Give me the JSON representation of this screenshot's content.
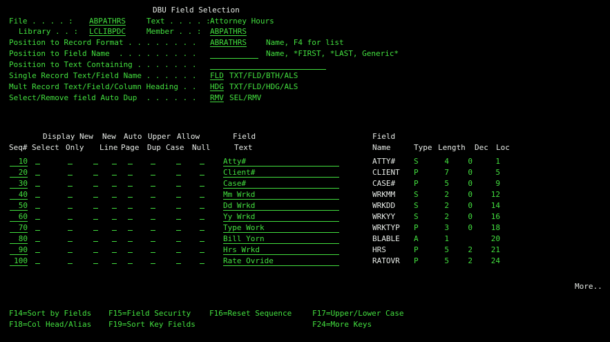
{
  "title": "DBU Field Selection",
  "header": {
    "file_label": "File . . . . :",
    "file_value": "ABPATHRS",
    "text_label": "Text . . . . :",
    "text_value": "Attorney Hours",
    "library_label": "Library . . :",
    "library_value": "LCLIBPDC",
    "member_label": "Member . . :",
    "member_value": "ABPATHRS",
    "pos_record_label": "Position to Record Format . . . . . . . .",
    "pos_record_value": "ABRATHRS",
    "pos_record_hint": "Name, F4 for list",
    "pos_field_label": "Position to Field Name  . . . . . . . . .",
    "pos_field_value": "",
    "pos_field_hint": "Name, *FIRST, *LAST, Generic*",
    "pos_text_label": "Position to Text Containing . . . . . . .",
    "pos_text_value": "",
    "single_label": "Single Record Text/Field Name . . . . . .",
    "single_value": "FLD",
    "single_hint": "TXT/FLD/BTH/ALS",
    "mult_label": "Mult Record Text/Field/Column Heading . .",
    "mult_value": "HDG",
    "mult_hint": "TXT/FLD/HDG/ALS",
    "select_label": "Select/Remove field Auto Dup  . . . . . .",
    "select_value": "RMV",
    "select_hint": "SEL/RMV"
  },
  "columns": {
    "row1": [
      "Display",
      "New",
      "New",
      "Auto",
      "Upper",
      "Allow",
      "Field",
      "Field"
    ],
    "row2": [
      "Seq#",
      "Select",
      "Only",
      "Line",
      "Page",
      "Dup",
      "Case",
      "Null",
      "Text",
      "Name",
      "Type",
      "Length",
      "Dec",
      "Loc"
    ]
  },
  "rows": [
    {
      "seq": "10",
      "text": "Atty#",
      "name": "ATTY#",
      "type": "S",
      "length": "4",
      "dec": "0",
      "loc": "1"
    },
    {
      "seq": "20",
      "text": "Client#",
      "name": "CLIENT",
      "type": "P",
      "length": "7",
      "dec": "0",
      "loc": "5"
    },
    {
      "seq": "30",
      "text": "Case#",
      "name": "CASE#",
      "type": "P",
      "length": "5",
      "dec": "0",
      "loc": "9"
    },
    {
      "seq": "40",
      "text": "Mm Wrkd",
      "name": "WRKMM",
      "type": "S",
      "length": "2",
      "dec": "0",
      "loc": "12"
    },
    {
      "seq": "50",
      "text": "Dd Wrkd",
      "name": "WRKDD",
      "type": "S",
      "length": "2",
      "dec": "0",
      "loc": "14"
    },
    {
      "seq": "60",
      "text": "Yy Wrkd",
      "name": "WRKYY",
      "type": "S",
      "length": "2",
      "dec": "0",
      "loc": "16"
    },
    {
      "seq": "70",
      "text": "Type Work",
      "name": "WRKTYP",
      "type": "P",
      "length": "3",
      "dec": "0",
      "loc": "18"
    },
    {
      "seq": "80",
      "text": "Bill Yorn",
      "name": "BLABLE",
      "type": "A",
      "length": "1",
      "dec": "",
      "loc": "20"
    },
    {
      "seq": "90",
      "text": "Hrs Wrkd",
      "name": "HRS",
      "type": "P",
      "length": "5",
      "dec": "2",
      "loc": "21"
    },
    {
      "seq": "100",
      "text": "Rate Ovride",
      "name": "RATOVR",
      "type": "P",
      "length": "5",
      "dec": "2",
      "loc": "24"
    }
  ],
  "more": "More..",
  "keys": {
    "f14": "F14=Sort by Fields",
    "f15": "F15=Field Security",
    "f16": "F16=Reset Sequence",
    "f17": "F17=Upper/Lower Case",
    "f18": "F18=Col Head/Alias",
    "f19": "F19=Sort Key Fields",
    "f24": "F24=More Keys"
  }
}
